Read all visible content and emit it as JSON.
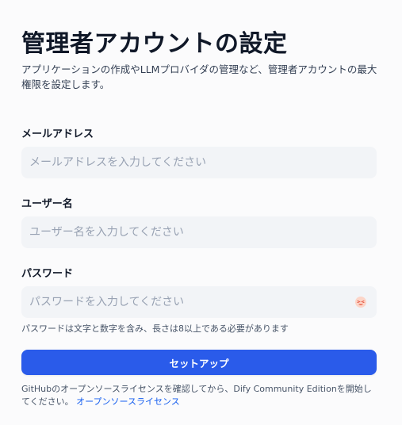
{
  "header": {
    "title": "管理者アカウントの設定",
    "subtitle": "アプリケーションの作成やLLMプロバイダの管理など、管理者アカウントの最大権限を設定します。"
  },
  "form": {
    "email": {
      "label": "メールアドレス",
      "placeholder": "メールアドレスを入力してください",
      "value": ""
    },
    "username": {
      "label": "ユーザー名",
      "placeholder": "ユーザー名を入力してください",
      "value": ""
    },
    "password": {
      "label": "パスワード",
      "placeholder": "パスワードを入力してください",
      "value": "",
      "toggle_icon": "eye-toggle-icon",
      "hint": "パスワードは文字と数字を含み、長さは8以上である必要があります"
    },
    "submit_label": "セットアップ"
  },
  "footer": {
    "text": "GitHubのオープンソースライセンスを確認してから、Dify Community Editionを開始してください。",
    "link_label": "オープンソースライセンス"
  },
  "colors": {
    "accent": "#2a5bea",
    "input_bg": "#f2f4f7",
    "link": "#155eef"
  }
}
